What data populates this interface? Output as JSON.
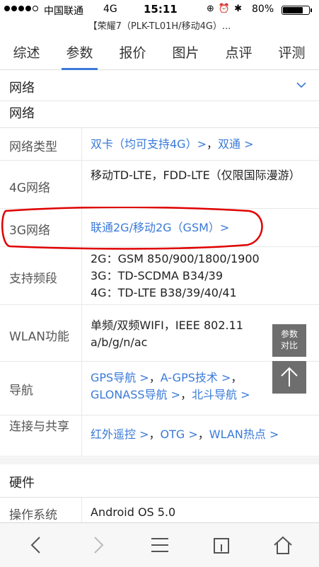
{
  "status_bar": {
    "carrier": "中国联通",
    "network": "4G",
    "time": "15:11",
    "battery": "80%",
    "battery_level": 0.8
  },
  "page": {
    "title": "【荣耀7（PLK-TL01H/移动4G）..."
  },
  "tabs": [
    {
      "label": "综述"
    },
    {
      "label": "参数"
    },
    {
      "label": "报价"
    },
    {
      "label": "图片"
    },
    {
      "label": "点评"
    },
    {
      "label": "评测"
    }
  ],
  "section": {
    "title": "网络",
    "subtitle": "网络"
  },
  "specs": {
    "network_type": {
      "label": "网络类型",
      "value_a": "双卡（均可支持4G）>",
      "sep": "，",
      "value_b": "双通 >"
    },
    "net_4g": {
      "label": "4G网络",
      "value": "移动TD-LTE，FDD-LTE（仅限国际漫游）"
    },
    "net_3g": {
      "label": "3G网络",
      "value": "联通2G/移动2G（GSM）>"
    },
    "bands": {
      "label": "支持频段",
      "line1": "2G：GSM 850/900/1800/1900",
      "line2": "3G：TD-SCDMA B34/39",
      "line3": "4G：TD-LTE B38/39/40/41"
    },
    "wlan": {
      "label": "WLAN功能",
      "value": "单频/双频WIFI，IEEE 802.11 a/b/g/n/ac"
    },
    "nav": {
      "label": "导航",
      "l1a": "GPS导航 >",
      "l1sep": "，",
      "l1b": "A-GPS技术 >",
      "l1end": "，",
      "l2a": "GLONASS导航 >",
      "l2sep": "，",
      "l2b": "北斗导航 >"
    },
    "connect": {
      "label": "连接与共享",
      "v1": "红外遥控 >",
      "s1": "，",
      "v2": "OTG >",
      "s2": "，",
      "v3": "WLAN热点 >"
    }
  },
  "hardware": {
    "title": "硬件",
    "os_label": "操作系统",
    "os_value": "Android OS 5.0"
  },
  "float": {
    "compare": "参数对比"
  },
  "colors": {
    "accent": "#3a7ad8",
    "annotation": "#e00000"
  }
}
